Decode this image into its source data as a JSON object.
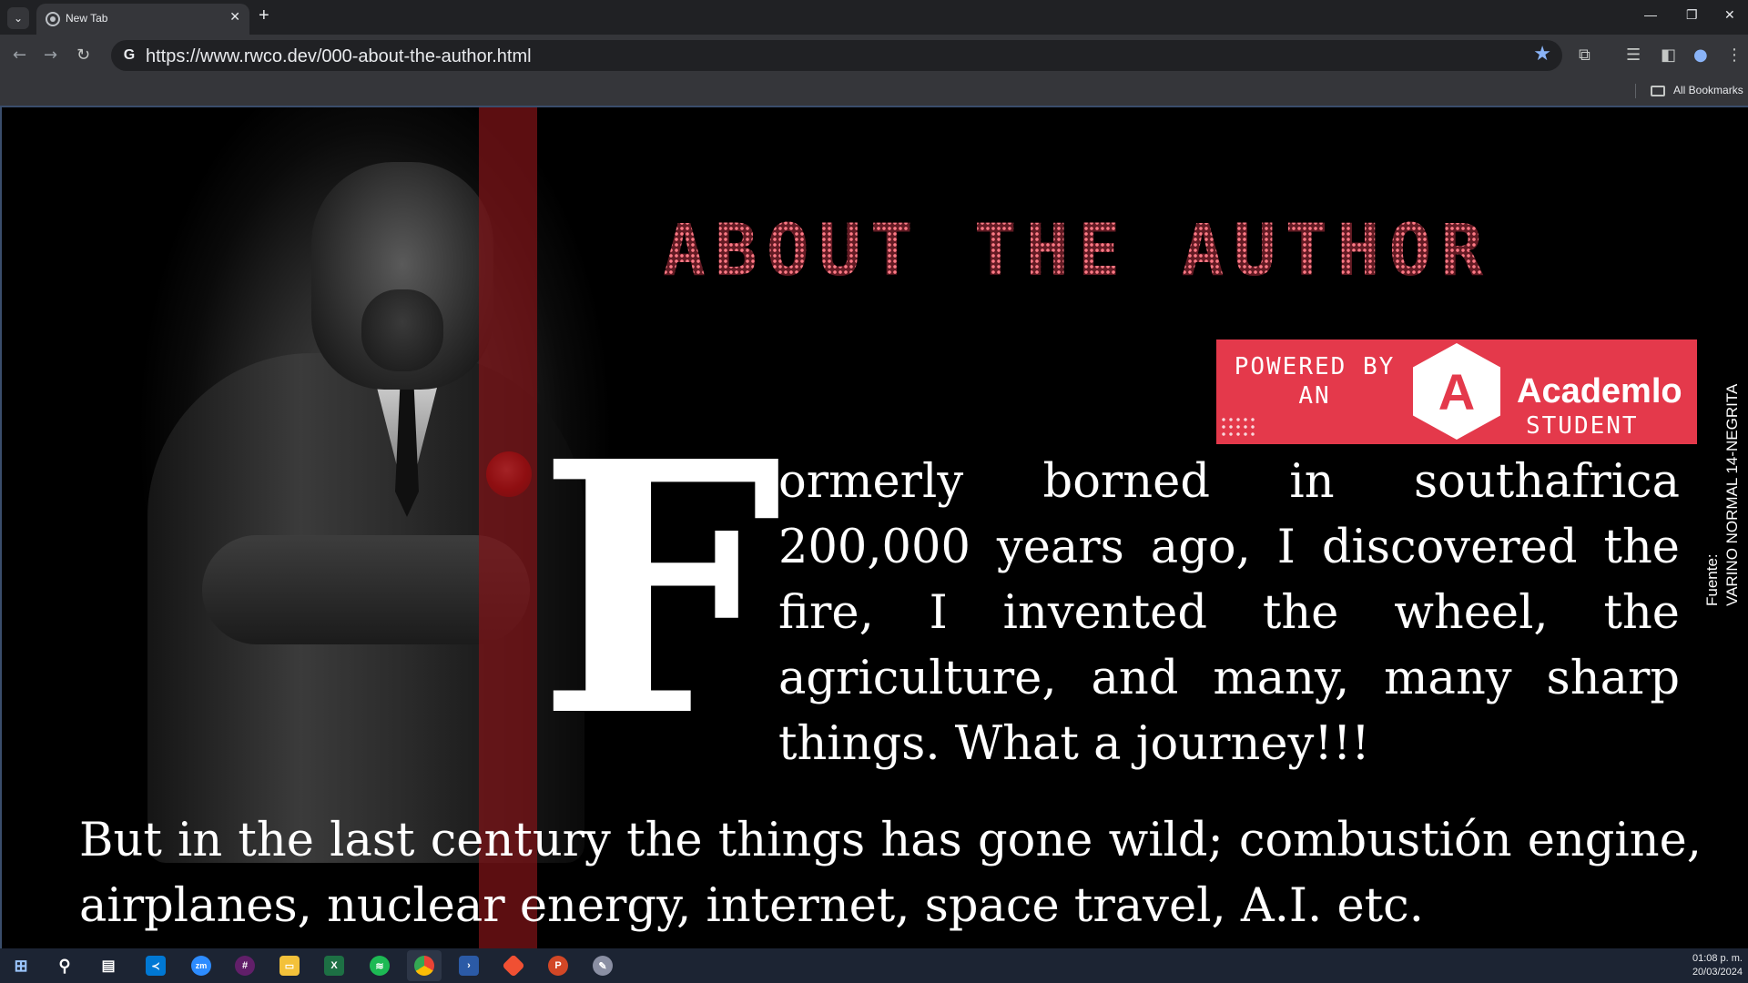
{
  "browser": {
    "tab_title": "New Tab",
    "tab_close": "✕",
    "new_tab": "+",
    "url": "https://www.rwco.dev/000-about-the-author.html",
    "bookmarks_label": "All Bookmarks",
    "controls": {
      "minimize": "—",
      "restore": "❐",
      "close": "✕"
    }
  },
  "page": {
    "heading": "ABOUT THE AUTHOR",
    "badge": {
      "powered": "POWERED BY AN",
      "logo_letter": "A",
      "name": "Academlo",
      "student": "STUDENT"
    },
    "vertical_note": {
      "line1": "Fuente:",
      "line2": "VARINO NORMAL 14-NEGRITA"
    },
    "dropcap": "F",
    "paragraph1": "ormerly borned in southafrica 200,000 years ago, I discovered the fire, I invented the wheel, the agriculture, and many, many sharp things. What a journey!!!",
    "paragraph2": "But in the last century the things has gone wild; combustión engine, airplanes, nuclear energy, internet, space travel, A.I. etc."
  },
  "taskbar": {
    "time": "01:08 p. m.",
    "date": "20/03/2024",
    "apps": [
      "start-icon",
      "search-icon",
      "task-view-icon",
      "vscode-icon",
      "zoom-icon",
      "slack-icon",
      "file-explorer-icon",
      "excel-icon",
      "spotify-icon",
      "chrome-icon",
      "terminal-icon",
      "git-icon",
      "powerpoint-icon",
      "paint-icon"
    ]
  },
  "colors": {
    "heading": "#ff6b78",
    "badge": "#e4394b",
    "stripe": "#801418"
  }
}
